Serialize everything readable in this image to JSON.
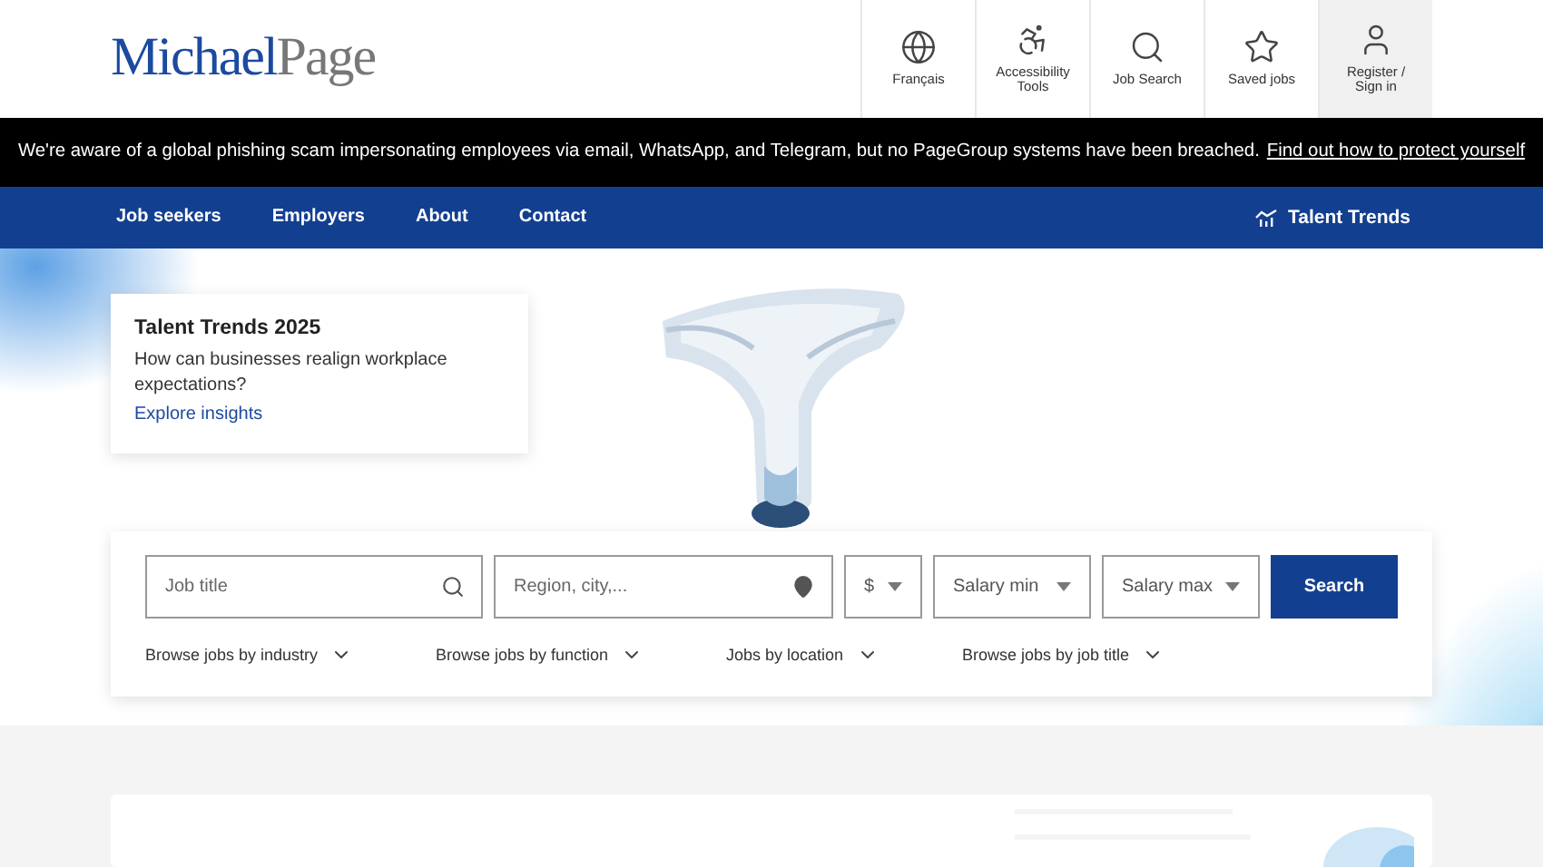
{
  "logo": {
    "first": "Michael",
    "second": "Page"
  },
  "utility_nav": [
    {
      "label": "Français",
      "selected": false
    },
    {
      "label": "Accessibility Tools",
      "selected": false
    },
    {
      "label": "Job Search",
      "selected": false
    },
    {
      "label": "Saved jobs",
      "selected": false
    },
    {
      "label": "Register / Sign in",
      "selected": true
    }
  ],
  "banner": {
    "text": "We're aware of a global phishing scam impersonating employees via email, WhatsApp, and Telegram, but no PageGroup systems have been breached.",
    "link": "Find out how to protect yourself"
  },
  "main_nav": {
    "items": [
      "Job seekers",
      "Employers",
      "About",
      "Contact"
    ],
    "talent_trends": "Talent Trends"
  },
  "promo": {
    "title": "Talent Trends 2025",
    "text": "How can businesses realign workplace expectations?",
    "link": "Explore insights"
  },
  "search": {
    "fields": [
      {
        "kind": "text",
        "placeholder": "Job title"
      },
      {
        "kind": "text",
        "placeholder": "Region, city,..."
      },
      {
        "kind": "select",
        "value": "$"
      },
      {
        "kind": "select",
        "value": "Salary min"
      },
      {
        "kind": "select",
        "value": "Salary max"
      }
    ],
    "button": "Search",
    "browse_links": [
      "Browse jobs by industry",
      "Browse jobs by function",
      "Jobs by location",
      "Browse jobs by job title"
    ]
  }
}
